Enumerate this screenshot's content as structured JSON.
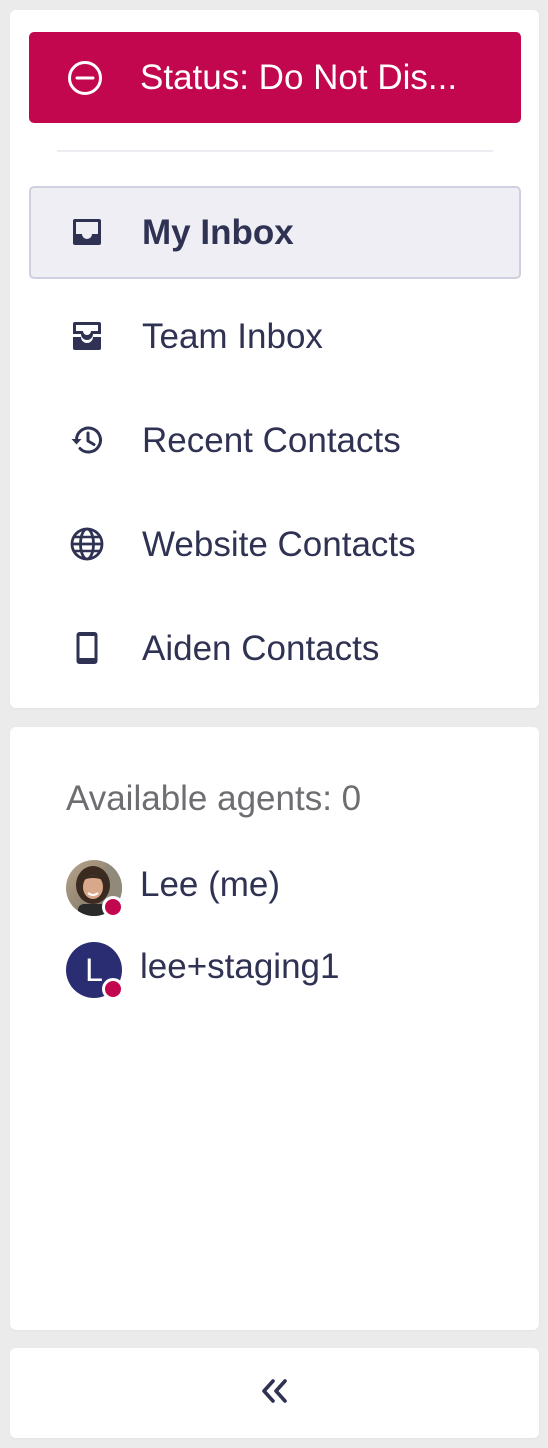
{
  "status": {
    "label": "Status: Do Not Dis...",
    "color": "#c2074e",
    "icon": "minus-circle-icon"
  },
  "nav": {
    "items": [
      {
        "label": "My Inbox",
        "icon": "inbox-icon",
        "active": true
      },
      {
        "label": "Team Inbox",
        "icon": "team-inbox-icon",
        "active": false
      },
      {
        "label": "Recent Contacts",
        "icon": "history-icon",
        "active": false
      },
      {
        "label": "Website Contacts",
        "icon": "globe-icon",
        "active": false
      },
      {
        "label": "Aiden Contacts",
        "icon": "mobile-phone-icon",
        "active": false
      }
    ]
  },
  "agents": {
    "title": "Available agents: 0",
    "list": [
      {
        "name": "Lee (me)",
        "avatar_type": "photo",
        "presence": "do-not-disturb"
      },
      {
        "name": "lee+staging1",
        "avatar_type": "letter",
        "avatar_letter": "L",
        "avatar_color": "#2b2d73",
        "presence": "do-not-disturb"
      }
    ],
    "presence_color": "#c2074e"
  },
  "collapse": {
    "icon": "double-chevron-left-icon",
    "glyph": "«"
  }
}
